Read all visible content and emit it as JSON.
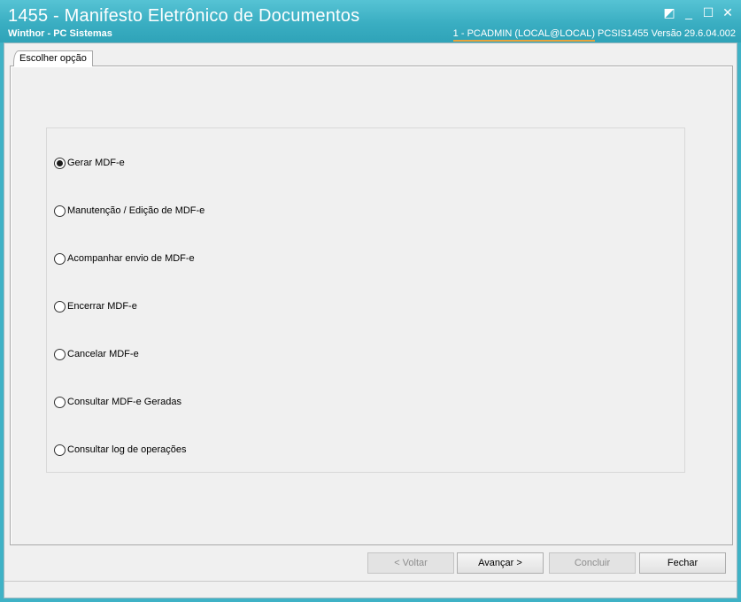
{
  "window": {
    "title": "1455 - Manifesto Eletrônico de Documentos",
    "subtitle": "Winthor - PC Sistemas",
    "user_info": "1 - PCADMIN (LOCAL@LOCAL)",
    "program_info": "PCSIS1455  Versão  29.6.04.002",
    "controls": {
      "restore_glyph": "◩",
      "minimize_glyph": "_",
      "maximize_glyph": "☐",
      "close_glyph": "✕"
    }
  },
  "tab": {
    "label": "Escolher opção"
  },
  "options": [
    {
      "label": "Gerar MDF-e",
      "selected": true
    },
    {
      "label": "Manutenção / Edição de MDF-e",
      "selected": false
    },
    {
      "label": "Acompanhar envio de MDF-e",
      "selected": false
    },
    {
      "label": "Encerrar MDF-e",
      "selected": false
    },
    {
      "label": "Cancelar MDF-e",
      "selected": false
    },
    {
      "label": "Consultar MDF-e Geradas",
      "selected": false
    },
    {
      "label": "Consultar log de operações",
      "selected": false
    }
  ],
  "buttons": {
    "back": "< Voltar",
    "next": "Avançar >",
    "finish": "Concluir",
    "close": "Fechar"
  },
  "colors": {
    "titlebar": "#3aaec2",
    "accent_underline": "#e8a33c"
  }
}
